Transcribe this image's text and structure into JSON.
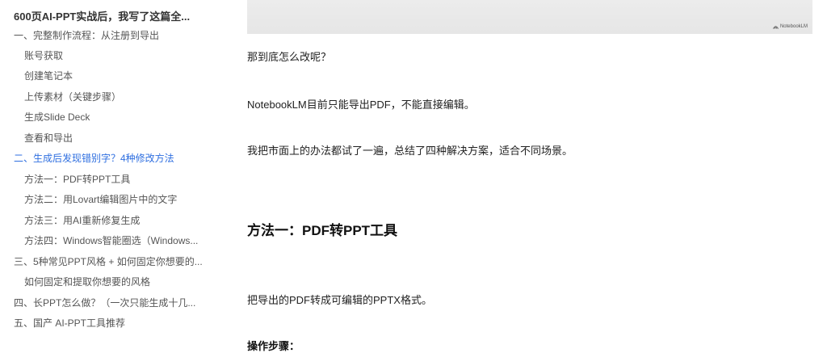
{
  "toc": {
    "title": "600页AI-PPT实战后，我写了这篇全...",
    "items": [
      {
        "label": "一、完整制作流程：从注册到导出"
      },
      {
        "label": "账号获取"
      },
      {
        "label": "创建笔记本"
      },
      {
        "label": "上传素材（关键步骤）"
      },
      {
        "label": "生成Slide Deck"
      },
      {
        "label": "查看和导出"
      },
      {
        "label": "二、生成后发现错别字？4种修改方法"
      },
      {
        "label": "方法一：PDF转PPT工具"
      },
      {
        "label": "方法二：用Lovart编辑图片中的文字"
      },
      {
        "label": "方法三：用AI重新修复生成"
      },
      {
        "label": "方法四：Windows智能圈选（Windows..."
      },
      {
        "label": "三、5种常见PPT风格 + 如何固定你想要的..."
      },
      {
        "label": "如何固定和提取你想要的风格"
      },
      {
        "label": "四、长PPT怎么做？（一次只能生成十几..."
      },
      {
        "label": "五、国产 AI-PPT工具推荐"
      }
    ]
  },
  "article": {
    "hero_brand": "NotebookLM",
    "p1": "那到底怎么改呢？",
    "p2": "NotebookLM目前只能导出PDF，不能直接编辑。",
    "p3": "我把市面上的办法都试了一遍，总结了四种解决方案，适合不同场景。",
    "h2": "方法一：PDF转PPT工具",
    "p4": "把导出的PDF转成可编辑的PPTX格式。",
    "sub": "操作步骤："
  },
  "colors": {
    "active_link": "#2f6fe0",
    "toc_text": "#555555"
  }
}
